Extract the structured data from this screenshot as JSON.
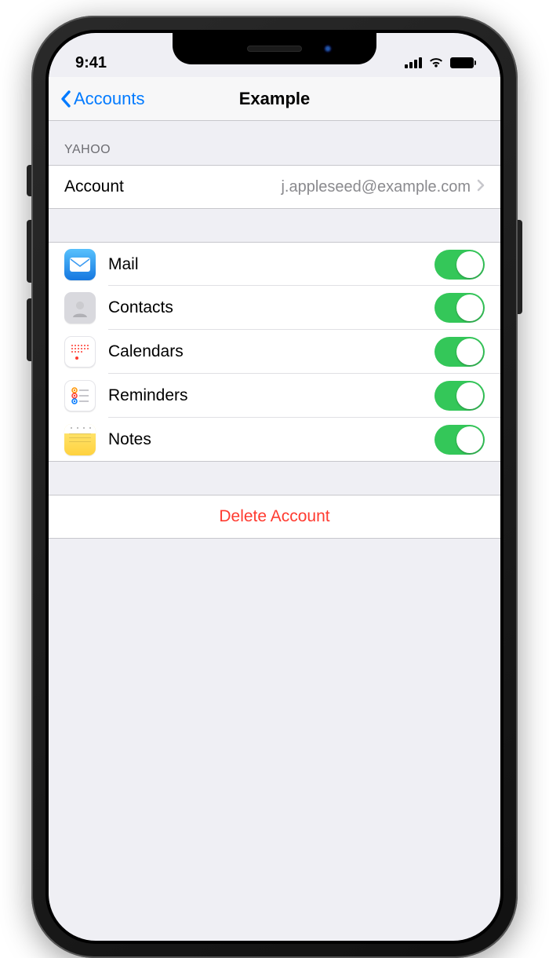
{
  "status": {
    "time": "9:41"
  },
  "nav": {
    "back": "Accounts",
    "title": "Example"
  },
  "section_header": "YAHOO",
  "account": {
    "label": "Account",
    "value": "j.appleseed@example.com"
  },
  "services": [
    {
      "key": "mail",
      "label": "Mail",
      "enabled": true
    },
    {
      "key": "contacts",
      "label": "Contacts",
      "enabled": true
    },
    {
      "key": "calendars",
      "label": "Calendars",
      "enabled": true
    },
    {
      "key": "reminders",
      "label": "Reminders",
      "enabled": true
    },
    {
      "key": "notes",
      "label": "Notes",
      "enabled": true
    }
  ],
  "delete_label": "Delete Account",
  "colors": {
    "tint": "#007aff",
    "toggle_on": "#34c759",
    "destructive": "#ff3b30"
  }
}
